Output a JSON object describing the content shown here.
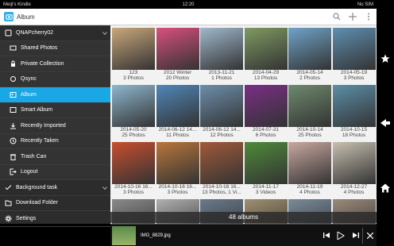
{
  "status": {
    "device": "Meiji's Kindle",
    "time": "12:20",
    "indicators": "No SIM"
  },
  "app": {
    "title": "Album"
  },
  "sidebar": {
    "items": [
      {
        "label": "QNAPcherry02",
        "icon": "nas-icon",
        "level": "top"
      },
      {
        "label": "Shared Photos",
        "icon": "shared-photos-icon",
        "level": "sub"
      },
      {
        "label": "Private Collection",
        "icon": "lock-icon",
        "level": "sub"
      },
      {
        "label": "Qsync",
        "icon": "sync-icon",
        "level": "sub"
      },
      {
        "label": "Album",
        "icon": "album-icon",
        "level": "sub",
        "active": true
      },
      {
        "label": "Smart Album",
        "icon": "smart-album-icon",
        "level": "sub"
      },
      {
        "label": "Recently Imported",
        "icon": "imported-icon",
        "level": "sub"
      },
      {
        "label": "Recently Taken",
        "icon": "clock-icon",
        "level": "sub"
      },
      {
        "label": "Trash Can",
        "icon": "trash-icon",
        "level": "sub"
      },
      {
        "label": "Logout",
        "icon": "logout-icon",
        "level": "sub"
      },
      {
        "label": "Background task",
        "icon": "task-icon",
        "level": "top"
      },
      {
        "label": "Download Folder",
        "icon": "folder-icon",
        "level": "top"
      },
      {
        "label": "Settings",
        "icon": "gear-icon",
        "level": "top"
      }
    ]
  },
  "albums": [
    {
      "title": "123",
      "count": "3 Photos",
      "color": "#c9a77a"
    },
    {
      "title": "2012 Winter",
      "count": "20 Photos",
      "color": "#d94f7e"
    },
    {
      "title": "2013-11-21",
      "count": "1 Photos",
      "color": "#9fb8cc"
    },
    {
      "title": "2014-04-29",
      "count": "13 Photos",
      "color": "#7e9a62"
    },
    {
      "title": "2014-05-14",
      "count": "2 Photos",
      "color": "#6fa3c8"
    },
    {
      "title": "2014-05-19",
      "count": "3 Photos",
      "color": "#5f8fb0"
    },
    {
      "title": "2014-05-20",
      "count": "25 Photos",
      "color": "#8fb7cf"
    },
    {
      "title": "2014-06-12 14...",
      "count": "11 Photos",
      "color": "#4f87b8"
    },
    {
      "title": "2014-06-12 14...",
      "count": "12 Photos",
      "color": "#6c8fab"
    },
    {
      "title": "2014-07-31",
      "count": "6 Photos",
      "color": "#7a2e86"
    },
    {
      "title": "2014-10-14",
      "count": "25 Photos",
      "color": "#6e8a6e"
    },
    {
      "title": "2014-10-15",
      "count": "18 Photos",
      "color": "#5b8fa8"
    },
    {
      "title": "2014-10-16 16...",
      "count": "3 Photos",
      "color": "#c84f2e"
    },
    {
      "title": "2014-10-16 16...",
      "count": "3 Photos",
      "color": "#b8763a"
    },
    {
      "title": "2014-10-16 16...",
      "count": "13 Photos, 1 Vi...",
      "color": "#a05a3a"
    },
    {
      "title": "2014-11-17",
      "count": "3 Videos",
      "color": "#4f8a3a"
    },
    {
      "title": "2014-11-19",
      "count": "4 Photos",
      "color": "#c9a8a0"
    },
    {
      "title": "2014-12-27",
      "count": "4 Photos",
      "color": "#c8c0b0"
    },
    {
      "title": "",
      "count": "",
      "color": "#8a8a8a"
    },
    {
      "title": "",
      "count": "",
      "color": "#b0b0b0"
    },
    {
      "title": "",
      "count": "",
      "color": "#6a7a8a"
    },
    {
      "title": "",
      "count": "",
      "color": "#a09070"
    },
    {
      "title": "",
      "count": "",
      "color": "#7a8a9a"
    },
    {
      "title": "",
      "count": "",
      "color": "#9a8a7a"
    }
  ],
  "footer": {
    "album_count": "48 albums",
    "filename": "IMG_8829.jpg"
  },
  "accent": "#1aa7e6"
}
